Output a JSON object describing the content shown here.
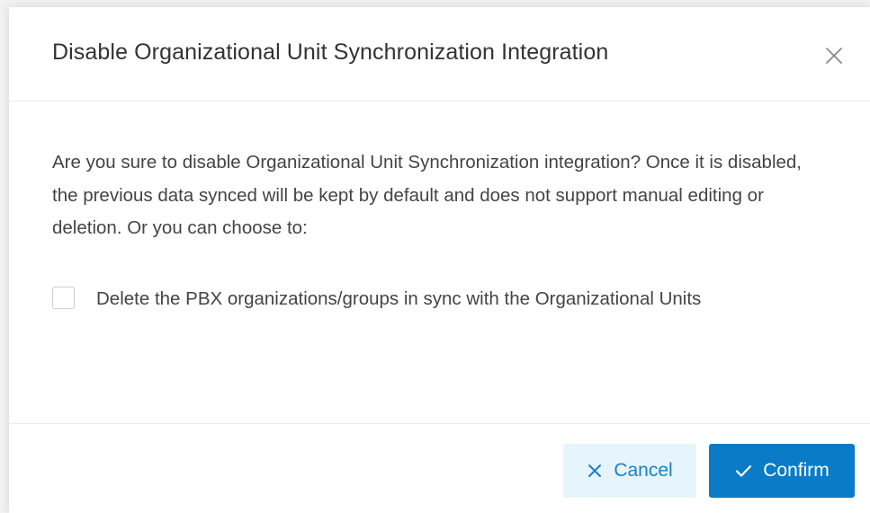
{
  "dialog": {
    "title": "Disable Organizational Unit Synchronization Integration",
    "close_icon": "close-icon",
    "message": "Are you sure to disable Organizational Unit Synchronization integration? Once it is disabled, the previous data synced will be kept by default and does not support manual editing or deletion. Or you can choose to:",
    "option": {
      "label": "Delete the PBX organizations/groups in sync with the Organizational Units",
      "checked": false
    },
    "buttons": {
      "cancel_label": "Cancel",
      "cancel_icon": "x-icon",
      "confirm_label": "Confirm",
      "confirm_icon": "check-icon"
    }
  },
  "colors": {
    "primary": "#0a7bc6",
    "cancel_bg": "#e6f4fc",
    "cancel_text": "#1a80c8",
    "text": "#444444"
  }
}
